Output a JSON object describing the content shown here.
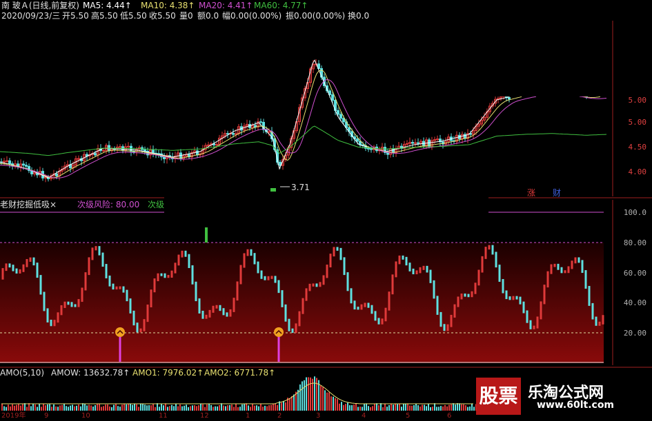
{
  "header": {
    "title": "南 玻Ａ(日线,前复权)",
    "ma5": "MA5: 4.44↑",
    "ma10": "MA10: 4.38↑",
    "ma20": "MA20: 4.41↑",
    "ma60": "MA60: 4.77↑",
    "date_line_prefix": "2020/09/23/三",
    "open": "开5.50",
    "high": "高5.50",
    "low": "低5.50",
    "close": "收5.50",
    "vol": "量0",
    "amount": "额0.0",
    "range": "幅0.00(0.00%)",
    "swing": "振0.00(0.00%)",
    "turnover": "换0.0"
  },
  "price_axis": [
    "5.00",
    "4.50",
    "4.00"
  ],
  "price_axis_extra": "5.00",
  "low_marker": "3.71",
  "top_right_tags": {
    "up": "涨",
    "cai": "财"
  },
  "indicator": {
    "title": "老财挖掘低吸×",
    "risk_label": "次级风险: 80.00",
    "next_label": "次级",
    "axis": [
      "100.0",
      "80.00",
      "60.00",
      "40.00",
      "20.00"
    ]
  },
  "volume": {
    "title": "AMO(5,10)",
    "amow": "AMOW: 13632.78↑",
    "amo1": "AMO1: 7976.02↑",
    "amo2": "AMO2: 6771.78↑",
    "dates": [
      "2019年",
      "9",
      "10",
      "11",
      "12",
      "1",
      "2",
      "3",
      "4",
      "5",
      "6"
    ]
  },
  "watermark": {
    "stock": "股票",
    "site": "乐淘公式网",
    "url": "www.60lt.com"
  },
  "colors": {
    "up": "#e03a3a",
    "down": "#5ee0e0",
    "ma5": "#ffffff",
    "ma10": "#e8e070",
    "ma20": "#d050d0",
    "ma60": "#40c040",
    "band": "#7a0000",
    "marker": "#f0a020"
  }
}
